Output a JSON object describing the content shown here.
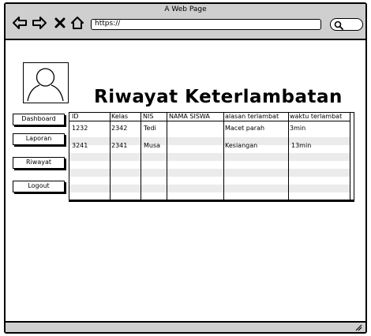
{
  "window": {
    "title": "A Web Page"
  },
  "toolbar": {
    "url": "https://",
    "icons": [
      "back-arrow-icon",
      "forward-arrow-icon",
      "close-icon",
      "home-icon",
      "search-icon"
    ]
  },
  "page": {
    "title": "Riwayat  Keterlambatan"
  },
  "sidebar": {
    "items": [
      {
        "label": "Dashboard"
      },
      {
        "label": "Laporan"
      },
      {
        "label": "Riwayat"
      },
      {
        "label": "Logout"
      }
    ]
  },
  "table": {
    "headers": [
      "ID",
      "Kelas",
      "NIS",
      "NAMA SISWA",
      "alasan terlambat",
      "waktu terlambat"
    ],
    "rows": [
      [
        "1232",
        "2342",
        "Tedi",
        "",
        "Macet parah",
        "3min"
      ],
      [
        "3241",
        "2341",
        "Musa",
        "",
        "Kesiangan",
        "13min"
      ]
    ]
  }
}
